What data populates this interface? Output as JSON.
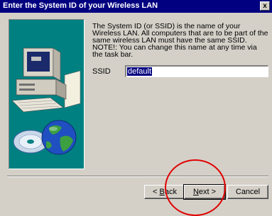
{
  "window": {
    "title": "Enter the System ID of your Wireless LAN",
    "close_glyph": "x"
  },
  "description": {
    "line1": "The System ID (or SSID) is the name of your Wireless LAN.  All computers that are to be part of the same wireless LAN must have the same SSID.",
    "line2": "NOTE!: You can change this name at any time via the task bar."
  },
  "ssid": {
    "label": "SSID",
    "value": "default"
  },
  "buttons": {
    "back": {
      "prefix": "< ",
      "accel": "B",
      "rest": "ack"
    },
    "next": {
      "accel": "N",
      "rest": "ext >"
    },
    "cancel": "Cancel"
  },
  "colors": {
    "title_bar": "#000080",
    "dialog_bg": "#d4d0c8",
    "art_bg": "#008080",
    "annotation": "#e00000"
  },
  "icons": [
    "computer-icon",
    "globe-icon",
    "disc-icon"
  ]
}
